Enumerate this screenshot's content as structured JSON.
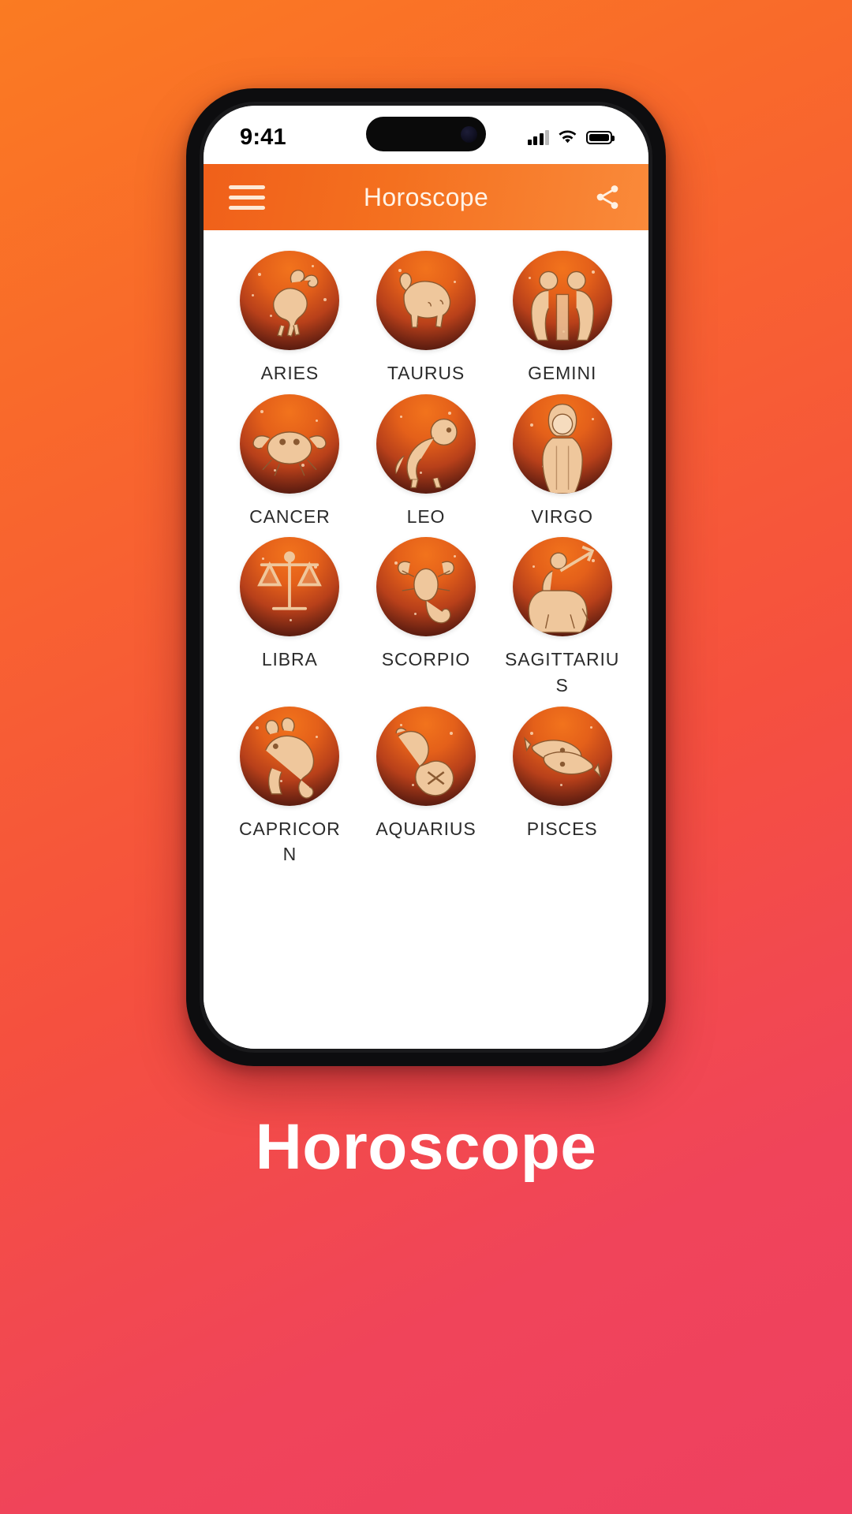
{
  "background": {
    "gradient_start": "#FA7B22",
    "gradient_end": "#EE4060"
  },
  "status_bar": {
    "time": "9:41",
    "signal_icon": "cellular-signal-icon",
    "wifi_icon": "wifi-icon",
    "battery_icon": "battery-full-icon"
  },
  "app_bar": {
    "menu_icon": "hamburger-menu-icon",
    "title": "Horoscope",
    "share_icon": "share-icon",
    "accent_color": "#F4701F",
    "title_color": "#FFF3E6"
  },
  "zodiac": {
    "signs": [
      {
        "label": "ARIES",
        "icon": "aries-ram-icon"
      },
      {
        "label": "TAURUS",
        "icon": "taurus-bull-icon"
      },
      {
        "label": "GEMINI",
        "icon": "gemini-twins-icon"
      },
      {
        "label": "CANCER",
        "icon": "cancer-crab-icon"
      },
      {
        "label": "LEO",
        "icon": "leo-lion-icon"
      },
      {
        "label": "VIRGO",
        "icon": "virgo-maiden-icon"
      },
      {
        "label": "LIBRA",
        "icon": "libra-scales-icon"
      },
      {
        "label": "SCORPIO",
        "icon": "scorpio-scorpion-icon"
      },
      {
        "label": "SAGITTARIUS",
        "icon": "sagittarius-archer-icon"
      },
      {
        "label": "CAPRICORN",
        "icon": "capricorn-goat-icon"
      },
      {
        "label": "AQUARIUS",
        "icon": "aquarius-waterbearer-icon"
      },
      {
        "label": "PISCES",
        "icon": "pisces-fish-icon"
      }
    ],
    "label_color": "#2B2B2B",
    "circle_color_top": "#F2731C",
    "circle_color_bottom": "#2B0C06",
    "glyph_color": "#F0CBA0"
  },
  "caption": {
    "text": "Horoscope",
    "color": "#FFFFFF"
  }
}
